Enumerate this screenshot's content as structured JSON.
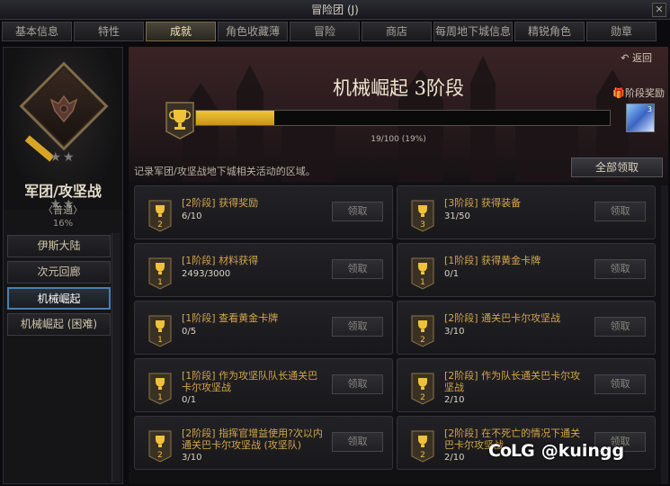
{
  "window": {
    "title": "冒险团 (J)",
    "close": "✕"
  },
  "tabs": [
    {
      "label": "基本信息",
      "active": false
    },
    {
      "label": "特性",
      "active": false
    },
    {
      "label": "成就",
      "active": true
    },
    {
      "label": "角色收藏薄",
      "active": false
    },
    {
      "label": "冒险",
      "active": false
    },
    {
      "label": "商店",
      "active": false
    },
    {
      "label": "每周地下城信息",
      "active": false
    },
    {
      "label": "精锐角色",
      "active": false
    },
    {
      "label": "勋章",
      "active": false
    }
  ],
  "left": {
    "stars": "★★",
    "group_title": "军团/攻坚战",
    "difficulty": "〈普通〉",
    "percent": "16%",
    "dungeons": [
      {
        "label": "伊斯大陆",
        "selected": false
      },
      {
        "label": "次元回廊",
        "selected": false
      },
      {
        "label": "机械崛起",
        "selected": true
      },
      {
        "label": "机械崛起 (困难)",
        "selected": false
      }
    ]
  },
  "main": {
    "back": "返回",
    "stage_title": "机械崛起 3阶段",
    "stage_reward_label": "阶段奖励",
    "reward_item_count": "3",
    "progress": {
      "current": 19,
      "total": 100,
      "text": "19/100 (19%)"
    },
    "description": "记录军团/攻坚战地下城相关活动的区域。",
    "claim_all": "全部领取",
    "claim_label": "领取",
    "achievements": [
      {
        "title": "[2阶段] 获得奖励",
        "progress": "6/10",
        "stage": "2"
      },
      {
        "title": "[3阶段] 获得装备",
        "progress": "31/50",
        "stage": "3"
      },
      {
        "title": "[1阶段] 材料获得",
        "progress": "2493/3000",
        "stage": "1"
      },
      {
        "title": "[1阶段] 获得黄金卡牌",
        "progress": "0/1",
        "stage": "1"
      },
      {
        "title": "[1阶段] 查看黄金卡牌",
        "progress": "0/5",
        "stage": "1"
      },
      {
        "title": "[2阶段] 通关巴卡尔攻坚战",
        "progress": "3/10",
        "stage": "2"
      },
      {
        "title": "[1阶段] 作为攻坚队队长通关巴卡尔攻坚战",
        "progress": "0/1",
        "stage": "1"
      },
      {
        "title": "[2阶段] 作为队长通关巴卡尔攻坚战",
        "progress": "2/10",
        "stage": "2"
      },
      {
        "title": "[2阶段] 指挥官增益使用?次以内通关巴卡尔攻坚战 (攻坚队)",
        "progress": "3/10",
        "stage": "2"
      },
      {
        "title": "[2阶段] 在不死亡的情况下通关巴卡尔攻坚战",
        "progress": "2/10",
        "stage": "2"
      }
    ]
  },
  "watermark": {
    "logo": "CoLG",
    "handle": "@kuingg"
  },
  "colors": {
    "accent_gold": "#d3a64a",
    "progress_fill": "#f2c43a",
    "selected_border": "#4a7fb3"
  }
}
